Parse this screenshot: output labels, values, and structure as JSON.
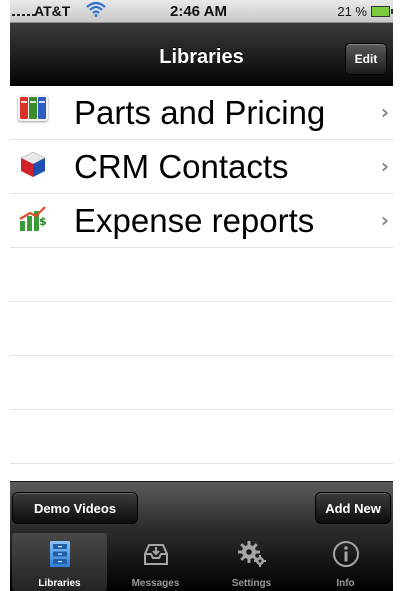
{
  "status_bar": {
    "carrier": "AT&T",
    "time": "2:46 AM",
    "battery": "21 %"
  },
  "nav_bar": {
    "title": "Libraries",
    "edit_label": "Edit"
  },
  "libraries": [
    {
      "label": "Parts and Pricing",
      "icon": "binders-icon"
    },
    {
      "label": "CRM Contacts",
      "icon": "cube-icon"
    },
    {
      "label": "Expense reports",
      "icon": "money-chart-icon"
    }
  ],
  "toolbar": {
    "demo_videos_label": "Demo Videos",
    "add_new_label": "Add New"
  },
  "tab_bar": {
    "tabs": [
      {
        "label": "Libraries",
        "icon": "cabinet-icon",
        "active": true
      },
      {
        "label": "Messages",
        "icon": "inbox-icon",
        "active": false
      },
      {
        "label": "Settings",
        "icon": "gear-icon",
        "active": false
      },
      {
        "label": "Info",
        "icon": "info-icon",
        "active": false
      }
    ]
  },
  "colors": {
    "wifi": "#2c6fd1",
    "battery": "#7ccc3f",
    "active_tab_icon": "#5aa0e6"
  }
}
